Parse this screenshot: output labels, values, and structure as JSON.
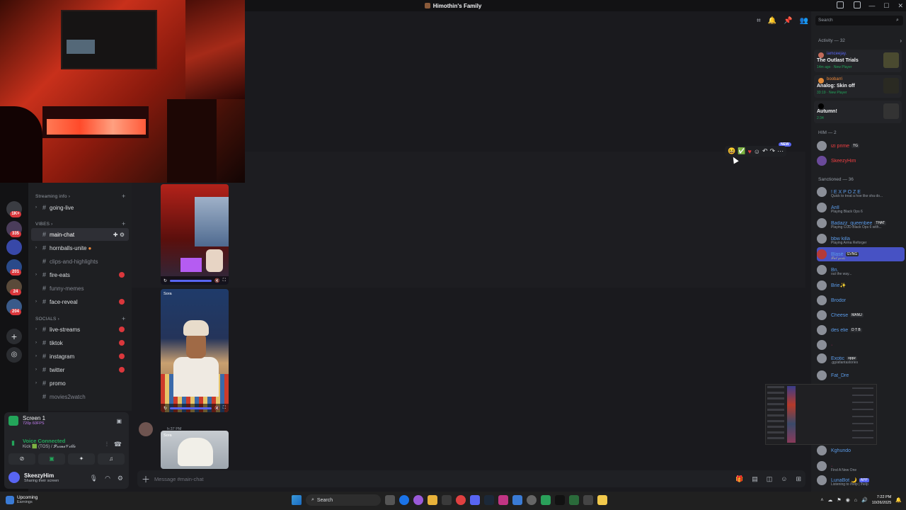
{
  "window": {
    "title": "Himothin's Family"
  },
  "search": {
    "placeholder": "Search"
  },
  "rail": {
    "badges": [
      "1K+",
      "335",
      "201",
      "24",
      "204"
    ]
  },
  "channels": {
    "categories": [
      {
        "label": "Streaming info"
      },
      {
        "label": "VIBES"
      },
      {
        "label": "SOCIALS"
      }
    ],
    "items": [
      {
        "label": "going-live"
      },
      {
        "label": "main-chat"
      },
      {
        "label": "hornballs-unite"
      },
      {
        "label": "clips-and-highlights"
      },
      {
        "label": "fire-eats"
      },
      {
        "label": "funny-memes"
      },
      {
        "label": "face-reveal"
      },
      {
        "label": "live-streams"
      },
      {
        "label": "tiktok"
      },
      {
        "label": "instagram"
      },
      {
        "label": "twitter"
      },
      {
        "label": "promo"
      },
      {
        "label": "movies2watch"
      }
    ]
  },
  "voice": {
    "screen_title": "Screen 1",
    "screen_sub": "720p 60FPS",
    "connected": "Voice Connected",
    "channel": "Kick 🟩 (TOS) / 𝓟𝓻𝓲𝓶𝓮𝓥𝓲𝓵𝓵𝓮",
    "user_name": "SkeezyHim",
    "user_status": "Sharing their screen"
  },
  "main": {
    "new_badge": "NEW",
    "sora_label": "Sora",
    "message_time": "h:37 PM",
    "composer_placeholder": "Message #main-chat"
  },
  "activity": {
    "header": "Activity — 32",
    "items": [
      {
        "user": "iamceejay.",
        "game": "The Outlast Trials",
        "detail": "14m ago · New Player"
      },
      {
        "user": "boobarri",
        "game": "Analog: Skin off",
        "detail": "33:19 · New Player"
      },
      {
        "user": "",
        "game": "Autumn!",
        "detail": "2:34"
      }
    ]
  },
  "members": {
    "him_header": "HIM — 2",
    "him": [
      {
        "name": "izi prime",
        "tag": "TG"
      },
      {
        "name": "SkeezyHim",
        "tag": ""
      }
    ],
    "sanctioned_header": "Sanctioned — 36",
    "sanctioned": [
      {
        "name": "! E X P O Z E",
        "status": "Quick to treat a hoe like sha do..."
      },
      {
        "name": "Arill",
        "status": "Playing Black Ops 6"
      },
      {
        "name": "Badazz_queenbee",
        "status": "Playing COD Black Ops 6 with...",
        "tag": "THAT"
      },
      {
        "name": "bbw killa",
        "status": "Playing Arma Reforger"
      },
      {
        "name": "Blasé",
        "status": "𝓕𝓾𝓵 𝓰𝓸𝓭𝓼",
        "tag": "GVNG"
      },
      {
        "name": "Bri.",
        "status": "out the way..."
      },
      {
        "name": "Brie✨",
        "status": ""
      },
      {
        "name": "Brodor",
        "status": ""
      },
      {
        "name": "Cheese",
        "status": "",
        "tag": "MANU"
      },
      {
        "name": "des elie",
        "status": "",
        "tag": "D T B"
      },
      {
        "name": "Exotic",
        "status": ".gg/atlantastories",
        "tag": "oppz"
      },
      {
        "name": "Fat_Dre",
        "status": ""
      },
      {
        "name": "Kghundo",
        "status": ""
      },
      {
        "name": "",
        "status": "Find A New One"
      },
      {
        "name": "LunaBot 🌙",
        "status": "Listening to /help | /help",
        "tag": "APP"
      }
    ]
  },
  "taskbar": {
    "weather_title": "Upcoming",
    "weather_sub": "Earnings",
    "search_label": "Search",
    "time": "7:22 PM",
    "date": "10/26/2025"
  },
  "colors": {
    "accent": "#5865f2",
    "online": "#23a55a",
    "alert": "#da373c"
  }
}
